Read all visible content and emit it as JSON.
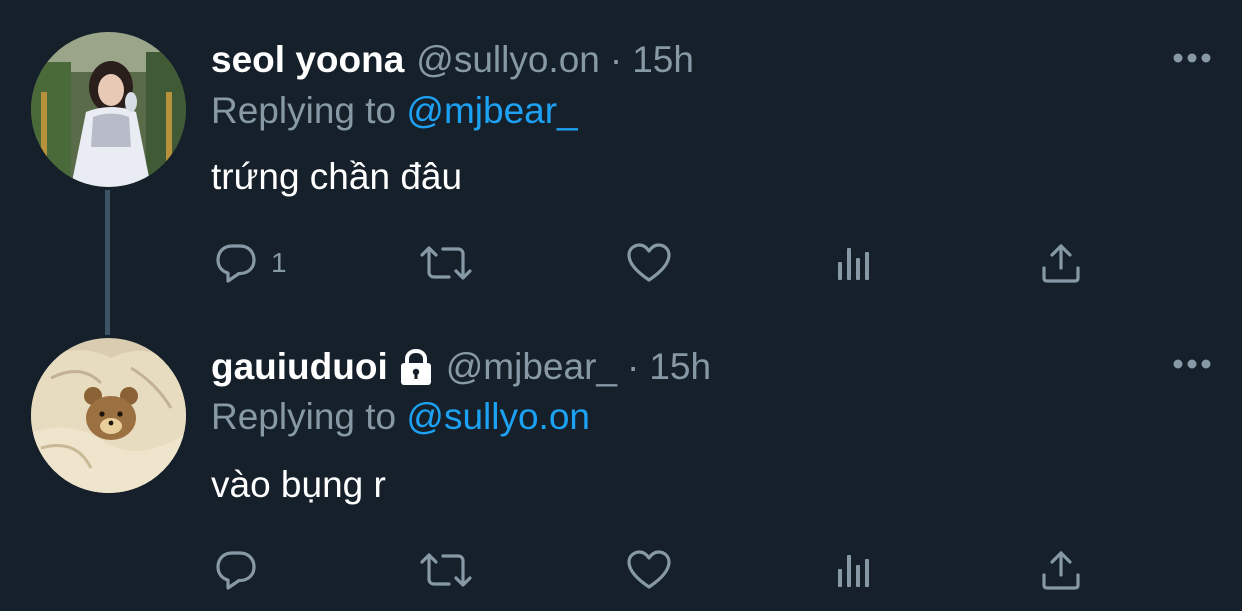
{
  "tweets": [
    {
      "display_name": "seol yoona",
      "handle": "@sullyo.on",
      "separator": "·",
      "time": "15h",
      "replying_prefix": "Replying to ",
      "replying_to": "@mjbear_",
      "text": "trứng chần đâu",
      "reply_count": "1",
      "avatar": "avatar-girl-white-dress",
      "protected": false
    },
    {
      "display_name": "gauiuduoi",
      "handle": "@mjbear_",
      "separator": "·",
      "time": "15h",
      "replying_prefix": "Replying to ",
      "replying_to": "@sullyo.on",
      "text": "vào bụng r",
      "reply_count": "",
      "avatar": "avatar-teddy-bear-blanket",
      "protected": true
    }
  ],
  "icons": {
    "more": "more-horizontal-icon",
    "reply": "reply-icon",
    "retweet": "retweet-icon",
    "like": "heart-icon",
    "analytics": "analytics-icon",
    "share": "share-icon",
    "lock": "lock-icon"
  },
  "colors": {
    "background": "#15202b",
    "text_primary": "#ffffff",
    "text_secondary": "#8899a6",
    "link": "#1da1f2",
    "thread_line": "#3d5466"
  }
}
